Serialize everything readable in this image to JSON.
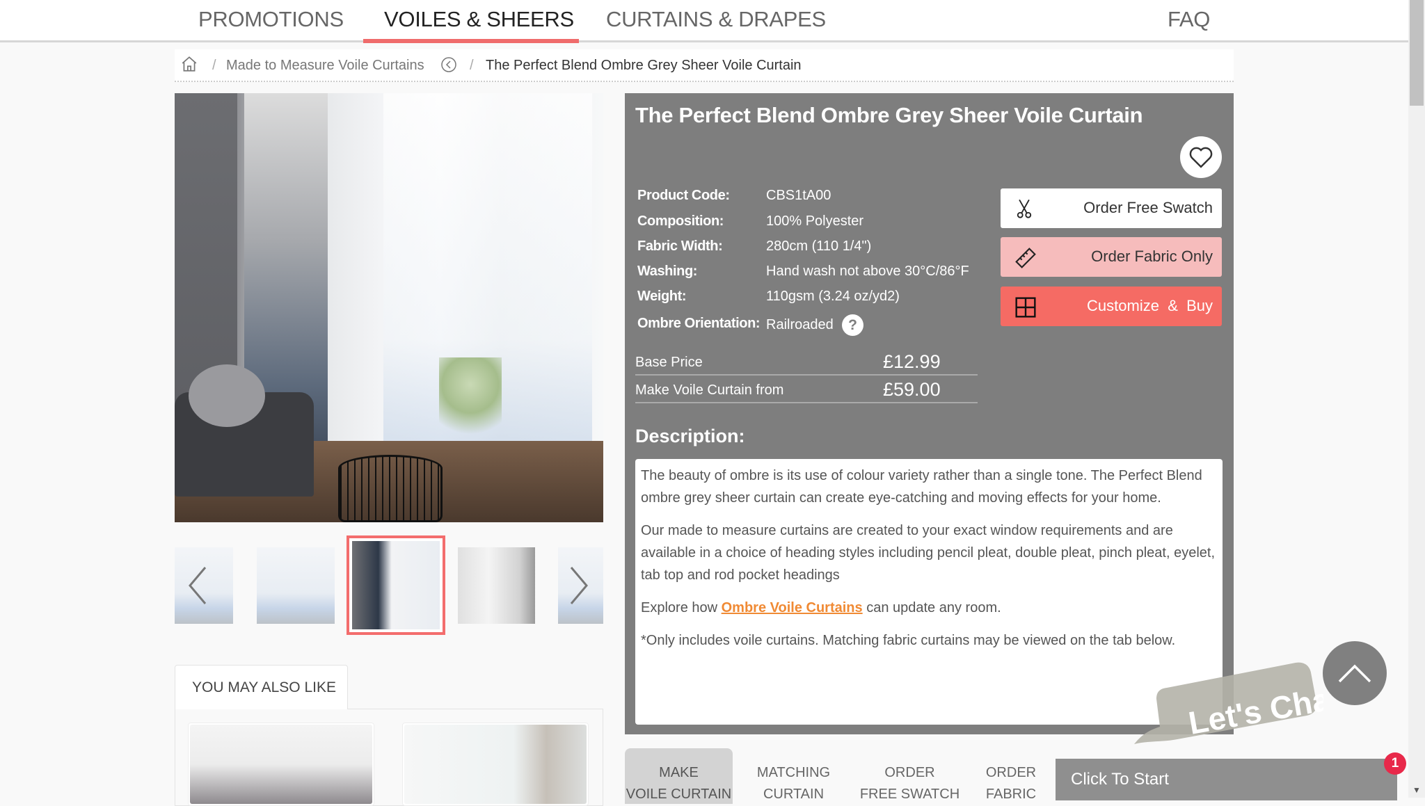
{
  "nav": {
    "items": [
      {
        "label": "PROMOTIONS",
        "active": false
      },
      {
        "label": "VOILES & SHEERS",
        "active": true
      },
      {
        "label": "CURTAINS & DRAPES",
        "active": false
      },
      {
        "label": "FAQ",
        "active": false
      }
    ],
    "accent_color": "#ef6b6b"
  },
  "breadcrumb": {
    "home_icon": "home-icon",
    "separator": "/",
    "items": [
      {
        "label": "Made to Measure Voile Curtains",
        "icon": "back-circle-icon"
      },
      {
        "label": "The Perfect Blend Ombre Grey Sheer Voile Curtain"
      }
    ]
  },
  "gallery": {
    "thumbnail_count_visible": 5,
    "active_thumbnail": 3,
    "prev_icon": "chevron-left-icon",
    "next_icon": "chevron-right-icon"
  },
  "also_like": {
    "tab_label": "YOU MAY ALSO LIKE"
  },
  "product": {
    "title": "The Perfect Blend Ombre Grey Sheer Voile Curtain",
    "wishlist_icon": "heart-icon",
    "specs": [
      {
        "label": "Product Code:",
        "value": "CBS1tA00"
      },
      {
        "label": "Composition:",
        "value": "100% Polyester"
      },
      {
        "label": "Fabric Width:",
        "value": "280cm (110 1/4\")"
      },
      {
        "label": "Washing:",
        "value": "Hand wash not above 30°C/86°F"
      },
      {
        "label": "Weight:",
        "value": "110gsm (3.24 oz/yd2)"
      },
      {
        "label": "Ombre Orientation:",
        "value": "Railroaded"
      }
    ],
    "help_glyph": "?",
    "prices": [
      {
        "label": "Base Price",
        "value": "£12.99"
      },
      {
        "label": "Make Voile Curtain from",
        "value": "£59.00"
      }
    ],
    "actions": {
      "swatch": "Order Free Swatch",
      "fabric": "Order Fabric Only",
      "customize": "Customize  &  Buy"
    },
    "description_heading": "Description:",
    "description": {
      "p1": "The beauty of ombre is its use of colour variety rather than a single tone. The Perfect Blend ombre grey sheer curtain can create eye-catching and moving effects for your home.",
      "p2": "Our made to measure curtains are created to your exact window requirements and are available in a choice of heading styles including pencil pleat, double pleat, pinch pleat, eyelet, tab top and rod pocket headings",
      "p3_before": "Explore how ",
      "p3_link": "Ombre Voile Curtains",
      "p3_after": " can update any room.",
      "p4": "*Only includes voile curtains. Matching fabric curtains may be viewed on the tab below."
    }
  },
  "bottom_tabs": [
    {
      "line1": "MAKE",
      "line2": "VOILE CURTAIN",
      "active": true
    },
    {
      "line1": "MATCHING",
      "line2": "CURTAIN",
      "active": false
    },
    {
      "line1": "ORDER",
      "line2": "FREE SWATCH",
      "active": false
    },
    {
      "line1": "ORDER",
      "line2": "FABRIC",
      "active": false
    }
  ],
  "chat": {
    "bubble_text": "Let's Chat",
    "bar_label": "Click To Start",
    "badge_count": "1"
  },
  "colors": {
    "panel_bg": "#7e7e7e",
    "customize_btn": "#f56b64",
    "fabric_btn": "#f6bcbc",
    "link": "#f08a34",
    "badge": "#e8294a"
  }
}
